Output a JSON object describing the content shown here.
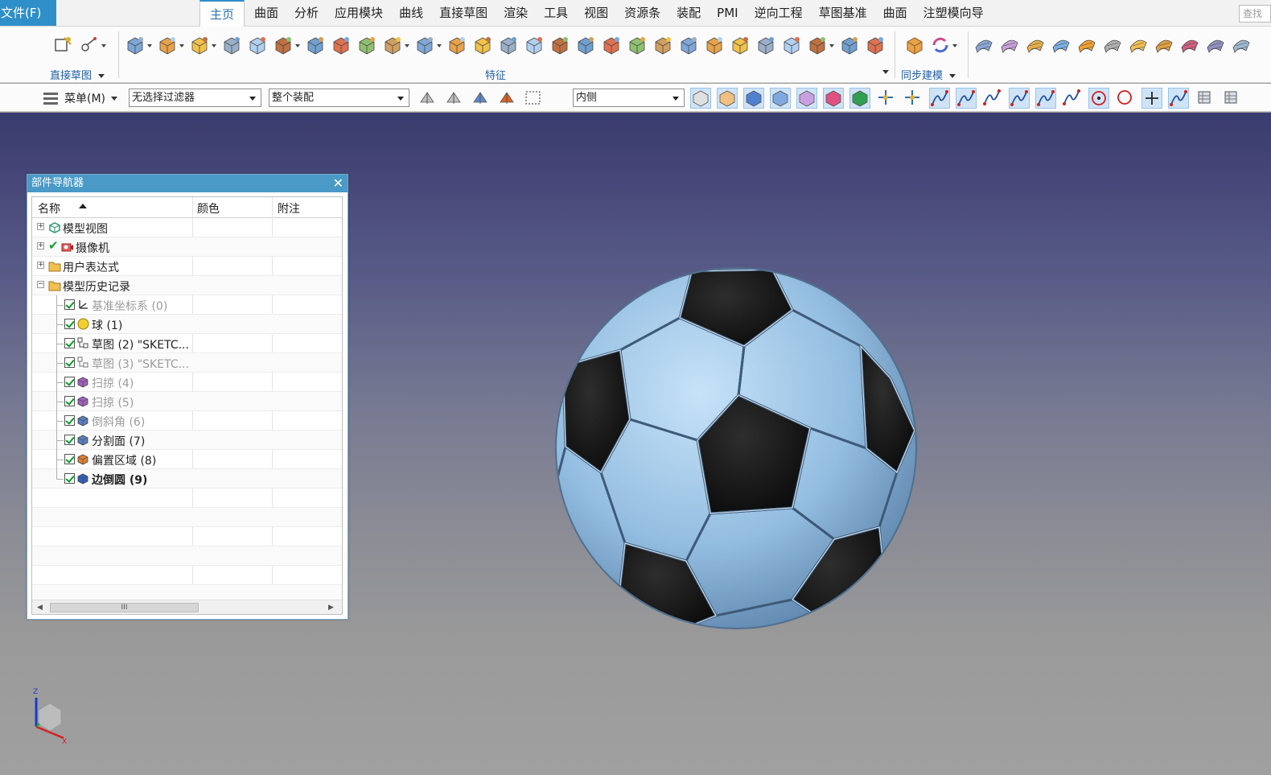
{
  "menubar": {
    "file_label": "文件(F)",
    "tabs": [
      "主页",
      "曲面",
      "分析",
      "应用模块",
      "曲线",
      "直接草图",
      "渲染",
      "工具",
      "视图",
      "资源条",
      "装配",
      "PMI",
      "逆向工程",
      "草图基准",
      "曲面",
      "注塑模向导"
    ],
    "active_tab": "主页",
    "search_placeholder": "查找"
  },
  "ribbon": {
    "groups": {
      "direct_sketch": "直接草图",
      "feature": "特征",
      "sync_modeling": "同步建模"
    }
  },
  "selection_bar": {
    "menu_label": "菜单(M)",
    "filter_value": "无选择过滤器",
    "scope_value": "整个装配",
    "snap_value": "内侧"
  },
  "navigator": {
    "title": "部件导航器",
    "columns": [
      "名称",
      "颜色",
      "附注"
    ],
    "rows": [
      {
        "label": "模型视图",
        "expander": "+",
        "state": "normal"
      },
      {
        "label": "摄像机",
        "expander": "+",
        "state": "normal"
      },
      {
        "label": "用户表达式",
        "expander": "+",
        "state": "normal"
      },
      {
        "label": "模型历史记录",
        "expander": "−",
        "state": "normal"
      },
      {
        "label": "基准坐标系 (0)",
        "state": "grey"
      },
      {
        "label": "球 (1)",
        "state": "normal"
      },
      {
        "label": "草图 (2) \"SKETC...",
        "state": "normal"
      },
      {
        "label": "草图 (3) \"SKETC...",
        "state": "grey"
      },
      {
        "label": "扫掠 (4)",
        "state": "grey"
      },
      {
        "label": "扫掠 (5)",
        "state": "grey"
      },
      {
        "label": "倒斜角 (6)",
        "state": "grey"
      },
      {
        "label": "分割面 (7)",
        "state": "normal"
      },
      {
        "label": "偏置区域 (8)",
        "state": "normal"
      },
      {
        "label": "边倒圆 (9)",
        "state": "bold"
      }
    ],
    "scroll_thumb_glyph": "III"
  },
  "triad": {
    "z_label": "Z",
    "x_label": "X"
  },
  "colors": {
    "accent": "#2f8fc9",
    "ball_panel": "#a8cdec",
    "ball_dark": "#151515",
    "viewport_top": "#3a3b6e",
    "viewport_bottom": "#a0a0a0"
  }
}
